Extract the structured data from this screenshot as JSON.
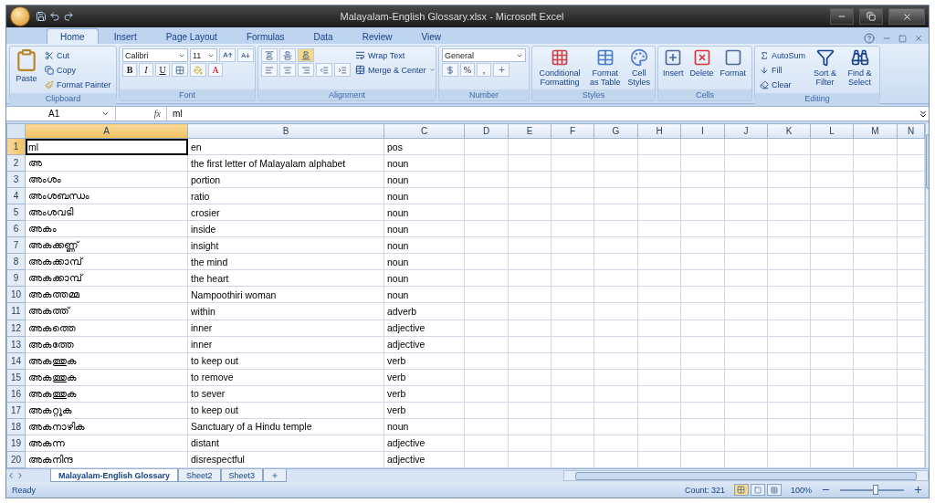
{
  "window": {
    "title": "Malayalam-English Glossary.xlsx - Microsoft Excel"
  },
  "ribbon_tabs": [
    {
      "label": "Home",
      "selected": true
    },
    {
      "label": "Insert",
      "selected": false
    },
    {
      "label": "Page Layout",
      "selected": false
    },
    {
      "label": "Formulas",
      "selected": false
    },
    {
      "label": "Data",
      "selected": false
    },
    {
      "label": "Review",
      "selected": false
    },
    {
      "label": "View",
      "selected": false
    }
  ],
  "clipboard": {
    "label": "Clipboard",
    "paste": "Paste",
    "cut": "Cut",
    "copy": "Copy",
    "format_painter": "Format Painter"
  },
  "font": {
    "label": "Font",
    "name": "Calibri",
    "size": "11",
    "bold": "B",
    "italic": "I",
    "underline": "U",
    "font_color": "A"
  },
  "alignment": {
    "label": "Alignment",
    "wrap_text": "Wrap Text",
    "merge_center": "Merge & Center"
  },
  "number": {
    "label": "Number",
    "format": "General",
    "percent": "%",
    "comma": ","
  },
  "styles": {
    "label": "Styles",
    "items": [
      "Conditional Formatting",
      "Format as Table",
      "Cell Styles"
    ]
  },
  "cells": {
    "label": "Cells",
    "items": [
      "Insert",
      "Delete",
      "Format"
    ]
  },
  "editing": {
    "label": "Editing",
    "autosum": "AutoSum",
    "fill": "Fill",
    "clear": "Clear",
    "sort_filter": "Sort & Filter",
    "find_select": "Find & Select"
  },
  "formula_bar": {
    "name_box": "A1",
    "function_label": "fx",
    "formula": "ml"
  },
  "columns": [
    {
      "label": "A",
      "selected": true
    },
    {
      "label": "B",
      "selected": false
    },
    {
      "label": "C",
      "selected": false
    },
    {
      "label": "D",
      "selected": false
    },
    {
      "label": "E",
      "selected": false
    },
    {
      "label": "F",
      "selected": false
    },
    {
      "label": "G",
      "selected": false
    },
    {
      "label": "H",
      "selected": false
    },
    {
      "label": "I",
      "selected": false
    },
    {
      "label": "J",
      "selected": false
    },
    {
      "label": "K",
      "selected": false
    },
    {
      "label": "L",
      "selected": false
    },
    {
      "label": "M",
      "selected": false
    },
    {
      "label": "N",
      "selected": false
    }
  ],
  "rows": [
    {
      "number": "1",
      "selected": true,
      "cells": [
        "ml",
        "en",
        "pos"
      ]
    },
    {
      "number": "2",
      "selected": false,
      "cells": [
        "അ",
        "the first letter of Malayalam alphabet",
        "noun"
      ]
    },
    {
      "number": "3",
      "selected": false,
      "cells": [
        "അംശം",
        "portion",
        "noun"
      ]
    },
    {
      "number": "4",
      "selected": false,
      "cells": [
        "അംശബന്ധം",
        "ratio",
        "noun"
      ]
    },
    {
      "number": "5",
      "selected": false,
      "cells": [
        "അംശവടി",
        "crosier",
        "noun"
      ]
    },
    {
      "number": "6",
      "selected": false,
      "cells": [
        "അകം",
        "inside",
        "noun"
      ]
    },
    {
      "number": "7",
      "selected": false,
      "cells": [
        "അകക്കണ്ണ്",
        "insight",
        "noun"
      ]
    },
    {
      "number": "8",
      "selected": false,
      "cells": [
        "അകക്കാമ്പ്",
        "the mind",
        "noun"
      ]
    },
    {
      "number": "9",
      "selected": false,
      "cells": [
        "അകക്കാമ്പ്",
        "the heart",
        "noun"
      ]
    },
    {
      "number": "10",
      "selected": false,
      "cells": [
        "അകത്തമ്മ",
        "Nampoothiri woman",
        "noun"
      ]
    },
    {
      "number": "11",
      "selected": false,
      "cells": [
        "അകത്ത്",
        "within",
        "adverb"
      ]
    },
    {
      "number": "12",
      "selected": false,
      "cells": [
        "അകത്തെ",
        "inner",
        "adjective"
      ]
    },
    {
      "number": "13",
      "selected": false,
      "cells": [
        "അകത്തേ",
        "inner",
        "adjective"
      ]
    },
    {
      "number": "14",
      "selected": false,
      "cells": [
        "അകത്തുക",
        "to keep out",
        "verb"
      ]
    },
    {
      "number": "15",
      "selected": false,
      "cells": [
        "അകത്തുക",
        "to remove",
        "verb"
      ]
    },
    {
      "number": "16",
      "selected": false,
      "cells": [
        "അകത്തുക",
        "to sever",
        "verb"
      ]
    },
    {
      "number": "17",
      "selected": false,
      "cells": [
        "അകറ്റുക",
        "to keep out",
        "verb"
      ]
    },
    {
      "number": "18",
      "selected": false,
      "cells": [
        "അകനാഴിക",
        "Sanctuary of a Hindu temple",
        "noun"
      ]
    },
    {
      "number": "19",
      "selected": false,
      "cells": [
        "അകന്ന",
        "distant",
        "adjective"
      ]
    },
    {
      "number": "20",
      "selected": false,
      "cells": [
        "അകനിന്ദ",
        "disrespectful",
        "adjective"
      ]
    }
  ],
  "sheet_tabs": [
    {
      "label": "Malayalam-English Glossary",
      "selected": true
    },
    {
      "label": "Sheet2",
      "selected": false
    },
    {
      "label": "Sheet3",
      "selected": false
    }
  ],
  "status_bar": {
    "status": "Ready",
    "count": "Count: 321",
    "zoom": "100%",
    "zoom_level": {
      "level": 0.55
    }
  }
}
